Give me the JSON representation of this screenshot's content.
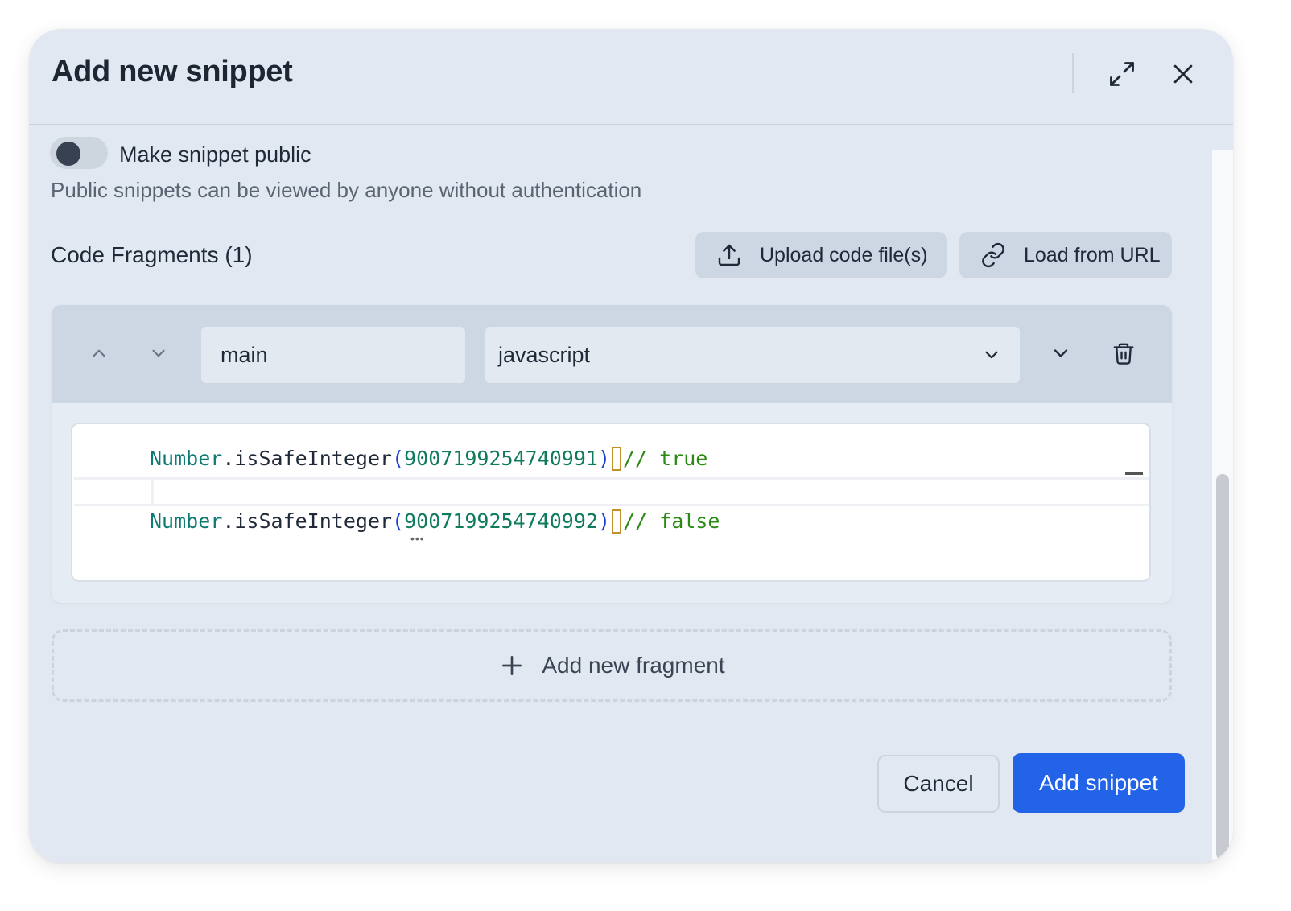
{
  "dialog": {
    "title": "Add new snippet",
    "icons": {
      "expand": "expand-arrows-icon",
      "close": "close-x-icon"
    }
  },
  "visibility": {
    "toggle_label": "Make snippet public",
    "toggle_on": false,
    "help_text": "Public snippets can be viewed by anyone without authentication"
  },
  "fragments_section": {
    "title": "Code Fragments (1)",
    "upload_label": "Upload code file(s)",
    "load_url_label": "Load from URL"
  },
  "fragment": {
    "name_value": "main",
    "language_value": "javascript",
    "code_lines": [
      {
        "object": "Number",
        "dot": ".",
        "method": "isSafeInteger",
        "open": "(",
        "number": "9007199254740991",
        "close": ")",
        "comment": "// true"
      },
      {
        "object": "Number",
        "dot": ".",
        "method": "isSafeInteger",
        "open": "(",
        "number": "9007199254740992",
        "close": ")",
        "comment": "// false"
      }
    ]
  },
  "add_fragment_label": "Add new fragment",
  "footer": {
    "cancel_label": "Cancel",
    "submit_label": "Add snippet"
  },
  "colors": {
    "primary": "#2363e8",
    "background": "#e2e8f1"
  }
}
